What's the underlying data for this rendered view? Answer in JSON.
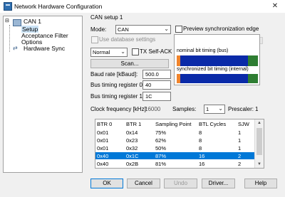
{
  "window": {
    "title": "Network Hardware Configuration",
    "close_glyph": "✕"
  },
  "tree": {
    "items": [
      {
        "label": "CAN 1"
      },
      {
        "label": "Setup"
      },
      {
        "label": "Acceptance Filter"
      },
      {
        "label": "Options"
      },
      {
        "label": "Hardware Sync"
      }
    ]
  },
  "can_setup": {
    "group_title": "CAN setup 1",
    "mode_label": "Mode:",
    "mode_value": "CAN",
    "preview_sync_label": "Preview synchronization edge",
    "use_db_label": "Use database settings",
    "output_mode_value": "Normal",
    "tx_self_ack_label": "TX Self-ACK",
    "scan_label": "Scan...",
    "baud_rate_label": "Baud rate [kBaud]:",
    "baud_rate_value": "500.0",
    "btr0_label": "Bus timing register 0:",
    "btr0_value": "40",
    "btr1_label": "Bus timing register 1:",
    "btr1_value": "1C",
    "clock_label": "Clock frequency [kHz]:",
    "clock_value": "16000",
    "samples_label": "Samples:",
    "samples_value": "1",
    "prescaler_label": "Prescaler:",
    "prescaler_value": "1",
    "nominal_timing_label": "nominal bit timing (bus)",
    "sync_timing_label": "synchronized bit timing (internal)"
  },
  "colors": {
    "sync_segment": "#f0842c",
    "prop_segment": "#0a2aa8",
    "phase2_segment": "#2e7d32",
    "selection": "#0078d7",
    "accent_border": "#0078d7"
  },
  "table": {
    "headers": [
      "BTR 0",
      "BTR 1",
      "Sampling Point",
      "BTL Cycles",
      "SJW"
    ],
    "rows": [
      [
        "0x01",
        "0x14",
        "75%",
        "8",
        "1"
      ],
      [
        "0x01",
        "0x23",
        "62%",
        "8",
        "1"
      ],
      [
        "0x01",
        "0x32",
        "50%",
        "8",
        "1"
      ],
      [
        "0x40",
        "0x1C",
        "87%",
        "16",
        "2"
      ],
      [
        "0x40",
        "0x2B",
        "81%",
        "16",
        "2"
      ]
    ],
    "selected_row": 3
  },
  "buttons": {
    "ok": "OK",
    "cancel": "Cancel",
    "undo": "Undo",
    "driver": "Driver...",
    "help": "Help"
  }
}
